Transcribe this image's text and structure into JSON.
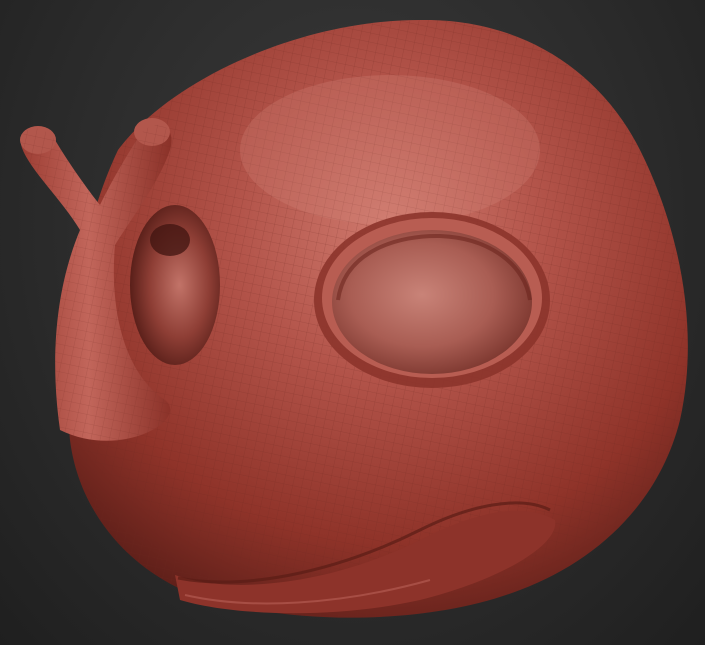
{
  "viewport": {
    "background_color": "#2c2c2c",
    "model_color": "#a8473c",
    "model_highlight_color": "#c9756a",
    "model_shadow_color": "#5e1f19"
  },
  "model": {
    "parts": [
      "head",
      "eye-socket",
      "forked-horn",
      "horn-base-cavity",
      "mouth-lip"
    ]
  }
}
